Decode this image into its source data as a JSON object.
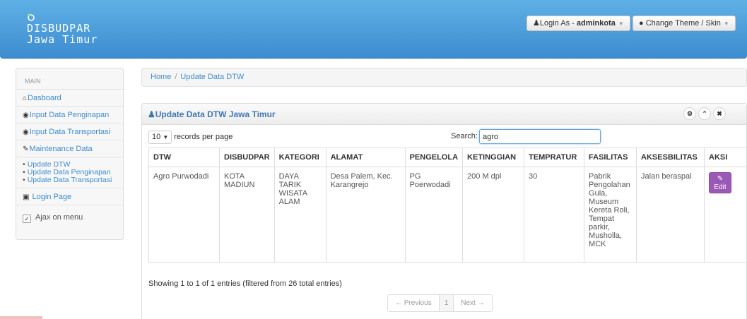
{
  "brand": {
    "line1": "DISBUDPAR",
    "line2": "Jawa Timur"
  },
  "header": {
    "login_prefix": "Login As - ",
    "login_user": "adminkota",
    "theme_label": "Change Theme / Skin"
  },
  "sidebar": {
    "section": "MAIN",
    "items": [
      {
        "icon": "home-icon",
        "label": "Dasboard"
      },
      {
        "icon": "eye-icon",
        "label": "Input Data Penginapan"
      },
      {
        "icon": "eye-icon",
        "label": "Input Data Transportasi"
      },
      {
        "icon": "edit-icon",
        "label": "Maintenance Data"
      }
    ],
    "subitems": [
      "Update DTW",
      "Update Data Penginapan",
      "Update Data Transportasi"
    ],
    "login_page": "Login Page",
    "ajax_label": "Ajax on menu"
  },
  "breadcrumb": {
    "home": "Home",
    "sep": "/",
    "current": "Update Data DTW"
  },
  "panel": {
    "title": "Update Data DTW Jawa Timur",
    "records_value": "10",
    "records_label": "records per page",
    "search_label": "Search:",
    "search_value": "agro",
    "columns": [
      "DTW",
      "DISBUDPAR",
      "KATEGORI",
      "ALAMAT",
      "PENGELOLA",
      "KETINGGIAN",
      "TEMPRATUR",
      "FASILITAS",
      "AKSESBILITAS",
      "AKSI"
    ],
    "row": {
      "dtw": "Agro Purwodadi",
      "disbudpar": "KOTA MADIUN",
      "kategori": "DAYA TARIK WISATA ALAM",
      "alamat": "Desa Palem, Kec. Karangrejo",
      "pengelola": "PG Poerwodadi",
      "ketinggian": "200 M dpl",
      "tempratur": "30",
      "fasilitas": "Pabrik Pengolahan Gula, Museum Kereta Roli, Tempat parkir, Musholla, MCK",
      "aksesbilitas": "Jalan beraspal",
      "edit_label": "Edit"
    },
    "info": "Showing 1 to 1 of 1 entries (filtered from 26 total entries)",
    "pager": {
      "prev": "← Previous",
      "page": "1",
      "next": "Next →"
    }
  },
  "colors": {
    "header": "#3d8ccf",
    "link": "#3d8bd0",
    "edit_button": "#9b59b6"
  }
}
